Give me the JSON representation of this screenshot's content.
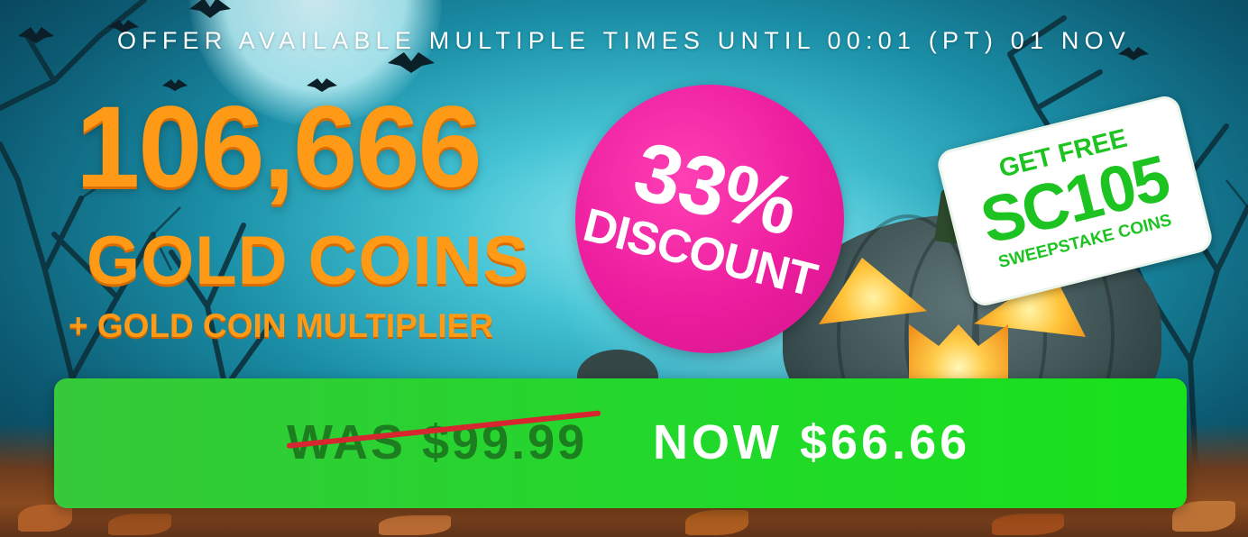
{
  "offer": {
    "headline": "OFFER AVAILABLE MULTIPLE TIMES UNTIL 00:01 (PT) 01 NOV"
  },
  "package": {
    "amount": "106,666",
    "currency_label": "GOLD COINS",
    "bonus_line": "+ GOLD COIN MULTIPLIER"
  },
  "discount_badge": {
    "percent": "33%",
    "label": "DISCOUNT",
    "color": "#ec1d9e"
  },
  "free_sc": {
    "intro": "GET FREE",
    "amount": "SC105",
    "label": "SWEEPSTAKE COINS",
    "color": "#1cc321"
  },
  "price": {
    "was": "WAS $99.99",
    "now": "NOW $66.66",
    "bar_color": "#22d82b",
    "strike_color": "#d7262f"
  },
  "theme": {
    "gold_color": "#ff9a16",
    "background_scene": "halloween-night-pumpkin"
  }
}
